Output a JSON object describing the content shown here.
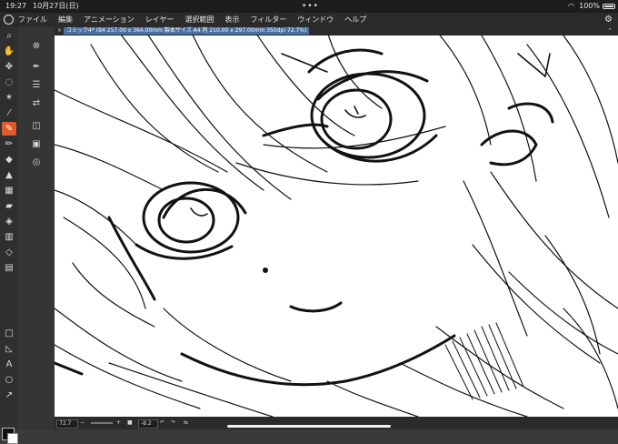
{
  "status_bar": {
    "time": "19:27",
    "date": "10月27日(日)",
    "battery": "100%"
  },
  "menu": {
    "items": [
      "ファイル",
      "編集",
      "アニメーション",
      "レイヤー",
      "選択範囲",
      "表示",
      "フィルター",
      "ウィンドウ",
      "ヘルプ"
    ]
  },
  "canvas_tab": {
    "title": "コミック4* (B4 257.00 x 364.00mm 製本サイズ A4 判 210.00 x 297.00mm 350dpi 72.7%)"
  },
  "bottom_bar": {
    "zoom": "72.7",
    "rotation": "-8.2"
  },
  "colors": {
    "accent": "#e05a2a",
    "tab_highlight": "#4a6fa0",
    "main_color": "#111111",
    "sub_color": "#ffffff"
  },
  "icons": {
    "tools": [
      "zoom-icon",
      "hand-icon",
      "move-icon",
      "lasso-icon",
      "magic-wand-icon",
      "eyedropper-icon",
      "pen-icon",
      "pencil-icon",
      "brush-icon",
      "airbrush-icon",
      "decoration-icon",
      "eraser-icon",
      "fill-icon",
      "gradient-icon",
      "figure-icon",
      "frame-icon",
      "text-icon",
      "balloon-icon",
      "ruler-icon",
      "color-swatch-icon"
    ],
    "sub_tools": [
      "compass-icon",
      "pen-nib-icon",
      "sliders-icon",
      "transfer-icon",
      "layers-icon",
      "navigator-icon",
      "stack-icon"
    ]
  }
}
